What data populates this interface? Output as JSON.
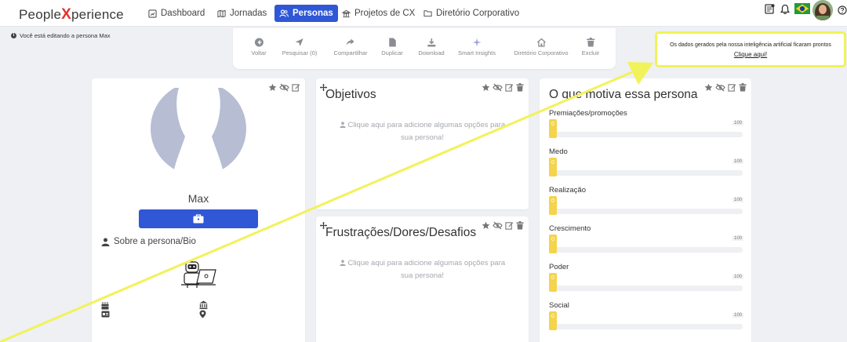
{
  "brand": {
    "left": "People",
    "x": "X",
    "right": "perience"
  },
  "nav": [
    {
      "label": "Dashboard",
      "icon": "dashboard-icon"
    },
    {
      "label": "Jornadas",
      "icon": "map-icon"
    },
    {
      "label": "Personas",
      "icon": "users-icon",
      "active": true
    },
    {
      "label": "Projetos de CX",
      "icon": "bank-icon"
    },
    {
      "label": "Diretório Corporativo",
      "icon": "folder-icon"
    }
  ],
  "edit_note": "Você está editando a persona Max",
  "toolbar": [
    {
      "label": "Voltar",
      "icon": "arrow-left-icon"
    },
    {
      "label": "Pesquisar (0)",
      "icon": "send-icon"
    },
    {
      "label": "Compartilhar",
      "icon": "share-icon"
    },
    {
      "label": "Duplicar",
      "icon": "file-icon"
    },
    {
      "label": "Download",
      "icon": "download-icon"
    },
    {
      "label": "Smart Insights",
      "icon": "sparkle-icon"
    },
    {
      "label": "Diretório Corporativo",
      "icon": "home-icon"
    },
    {
      "label": "Excluir",
      "icon": "trash-icon"
    }
  ],
  "ai_notice": {
    "text": "Os dados gerados pela nossa inteligência artificial ficaram prontos",
    "link": "Clique aqui!"
  },
  "persona": {
    "name": "Max",
    "bio_label": "Sobre a persona/Bio"
  },
  "objetivos": {
    "title": "Objetivos",
    "empty_line1": "Clique aqui para adicione algumas opções para",
    "empty_line2": "sua persona!"
  },
  "frustracoes": {
    "title": "Frustrações/Dores/Desafios",
    "empty_line1": "Clique aqui para adicione algumas opções para",
    "empty_line2": "sua persona!"
  },
  "motivacao": {
    "title": "O que motiva essa persona",
    "items": [
      {
        "label": "Premiações/promoções",
        "value": "0",
        "max": "100"
      },
      {
        "label": "Medo",
        "value": "0",
        "max": "100"
      },
      {
        "label": "Realização",
        "value": "0",
        "max": "100"
      },
      {
        "label": "Crescimento",
        "value": "0",
        "max": "100"
      },
      {
        "label": "Poder",
        "value": "0",
        "max": "100"
      },
      {
        "label": "Social",
        "value": "0",
        "max": "100"
      }
    ]
  },
  "colors": {
    "accent": "#2f57d6",
    "highlight": "#f2f25a",
    "bar": "#f4d44c",
    "brand_x": "#e5322d"
  }
}
